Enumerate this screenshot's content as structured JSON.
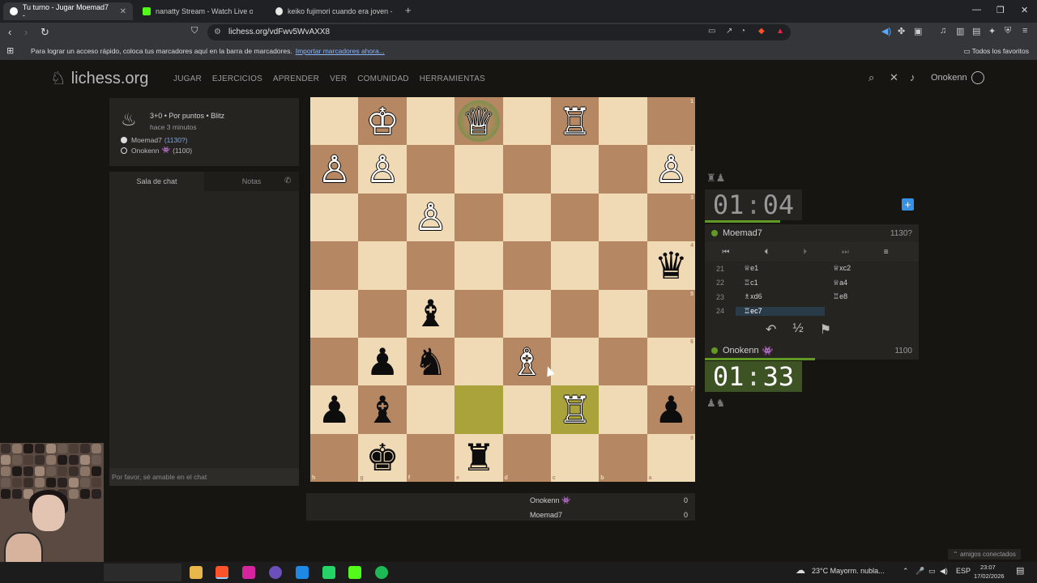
{
  "browser": {
    "tabs": [
      {
        "title": "Tu turno - Jugar Moemad7 -",
        "active": true,
        "color": "#ffffff"
      },
      {
        "title": "nanatty Stream - Watch Live on K",
        "active": false,
        "color": "#53fc18"
      },
      {
        "title": "keiko fujimori cuando era joven - Bu",
        "active": false,
        "color": "#e8e8e8"
      }
    ],
    "url": "lichess.org/vdFwv5WvAXX8",
    "bookmarks_msg": "Para lograr un acceso rápido, coloca tus marcadores aquí en la barra de marcadores.",
    "bookmarks_link": "Importar marcadores ahora...",
    "all_favorites": "Todos los favoritos"
  },
  "site": {
    "name": "lichess.org",
    "nav": [
      "JUGAR",
      "EJERCICIOS",
      "APRENDER",
      "VER",
      "COMUNIDAD",
      "HERRAMIENTAS"
    ],
    "username": "Onokenn"
  },
  "game": {
    "setup": "3+0 • Por puntos • Blitz",
    "ago": "hace 3 minutos",
    "white_player": "Moemad7",
    "white_rating": "(1130?)",
    "black_player": "Onokenn",
    "black_rating": "(1100)"
  },
  "chat": {
    "tab_chat": "Sala de chat",
    "tab_notes": "Notas",
    "placeholder": "Por favor, sé amable en el chat"
  },
  "board": {
    "ranks": [
      "1",
      "2",
      "3",
      "4",
      "5",
      "6",
      "7",
      "8"
    ],
    "files": [
      "h",
      "g",
      "f",
      "e",
      "d",
      "c",
      "b",
      "a"
    ],
    "rows": [
      [
        " ",
        "♔",
        " ",
        "♕",
        " ",
        "♖",
        " ",
        " "
      ],
      [
        "♙",
        "♙",
        " ",
        " ",
        " ",
        " ",
        " ",
        "♙"
      ],
      [
        " ",
        " ",
        "♙",
        " ",
        " ",
        " ",
        " ",
        " "
      ],
      [
        " ",
        " ",
        " ",
        " ",
        " ",
        " ",
        " ",
        "♛"
      ],
      [
        " ",
        " ",
        "♝",
        " ",
        " ",
        " ",
        " ",
        " "
      ],
      [
        " ",
        "♟",
        "♞",
        " ",
        "♗",
        " ",
        " ",
        " "
      ],
      [
        "♟",
        "♝",
        " ",
        " ",
        " ",
        "♖",
        " ",
        "♟"
      ],
      [
        " ",
        "♚",
        " ",
        "♜",
        " ",
        " ",
        " ",
        " "
      ]
    ]
  },
  "clocks": {
    "opponent_min": "01",
    "opponent_sec": "04",
    "me_min": "01",
    "me_sec": "33"
  },
  "opponent": {
    "name": "Moemad7",
    "rating": "1130?"
  },
  "me": {
    "name": "Onokenn",
    "badge": "👾",
    "rating": "1100"
  },
  "moves": [
    {
      "n": "21",
      "w": "♕e1",
      "b": "♕xc2"
    },
    {
      "n": "22",
      "w": "♖c1",
      "b": "♕a4"
    },
    {
      "n": "23",
      "w": "♗xd6",
      "b": "♖e8"
    },
    {
      "n": "24",
      "w": "♖ec7",
      "b": ""
    }
  ],
  "scores": [
    {
      "name": "Onokenn 👾",
      "score": "0"
    },
    {
      "name": "Moemad7",
      "score": "0"
    }
  ],
  "taskbar": {
    "weather": "23°C  Mayorm. nubla...",
    "lang": "ESP",
    "time": "23:07",
    "date": "17/02/2026"
  },
  "friends": "amigos conectados",
  "colors": {
    "light": "#f0d9b5",
    "dark": "#b58863",
    "accent": "#629924",
    "link": "#7fa6d9"
  }
}
